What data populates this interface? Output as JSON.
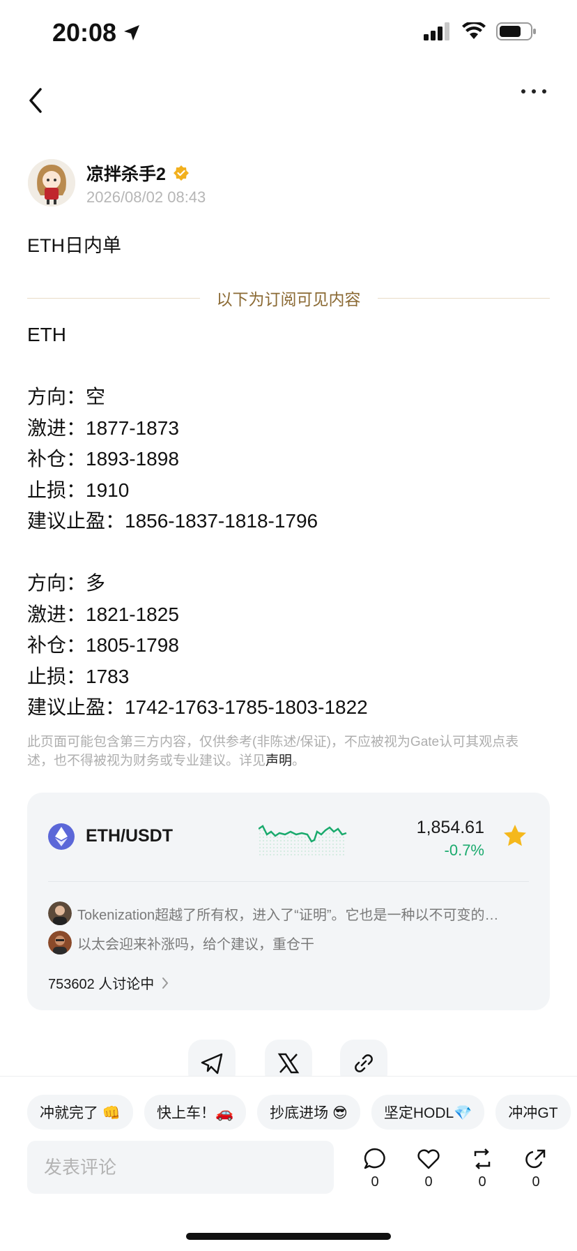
{
  "status_bar": {
    "time": "20:08"
  },
  "author": {
    "name": "凉拌杀手2",
    "date": "2026/08/02 08:43"
  },
  "post": {
    "title": "ETH日内单",
    "divider_text": "以下为订阅可见内容",
    "lines": [
      "ETH",
      "",
      "方向：空",
      "激进：1877-1873",
      "补仓：1893-1898",
      "止损：1910",
      "建议止盈：1856-1837-1818-1796",
      "",
      "方向：多",
      "激进：1821-1825",
      "补仓：1805-1798",
      "止损：1783",
      "建议止盈：1742-1763-1785-1803-1822"
    ]
  },
  "disclaimer": {
    "text": "此页面可能包含第三方内容，仅供参考(非陈述/保证)，不应被视为Gate认可其观点表述，也不得被视为财务或专业建议。详见",
    "link": "声明",
    "end": "。"
  },
  "market_card": {
    "pair": "ETH/USDT",
    "price": "1,854.61",
    "change": "-0.7%",
    "up_color": "#1aaa6d",
    "discussions": [
      {
        "text": "Tokenization超越了所有权，进入了“证明”。它也是一种以不可变的…"
      },
      {
        "text": "以太会迎来补涨吗，给个建议，重仓干"
      }
    ],
    "discuss_count": "753602 人讨论中"
  },
  "reactions": [
    "冲就完了 👊",
    "快上车！🚗",
    "抄底进场 😎",
    "坚定HODL💎",
    "冲冲GT"
  ],
  "comment": {
    "placeholder": "发表评论"
  },
  "actions": [
    {
      "icon": "comment-icon",
      "count": "0"
    },
    {
      "icon": "like-icon",
      "count": "0"
    },
    {
      "icon": "repost-icon",
      "count": "0"
    },
    {
      "icon": "share-icon",
      "count": "0"
    }
  ]
}
